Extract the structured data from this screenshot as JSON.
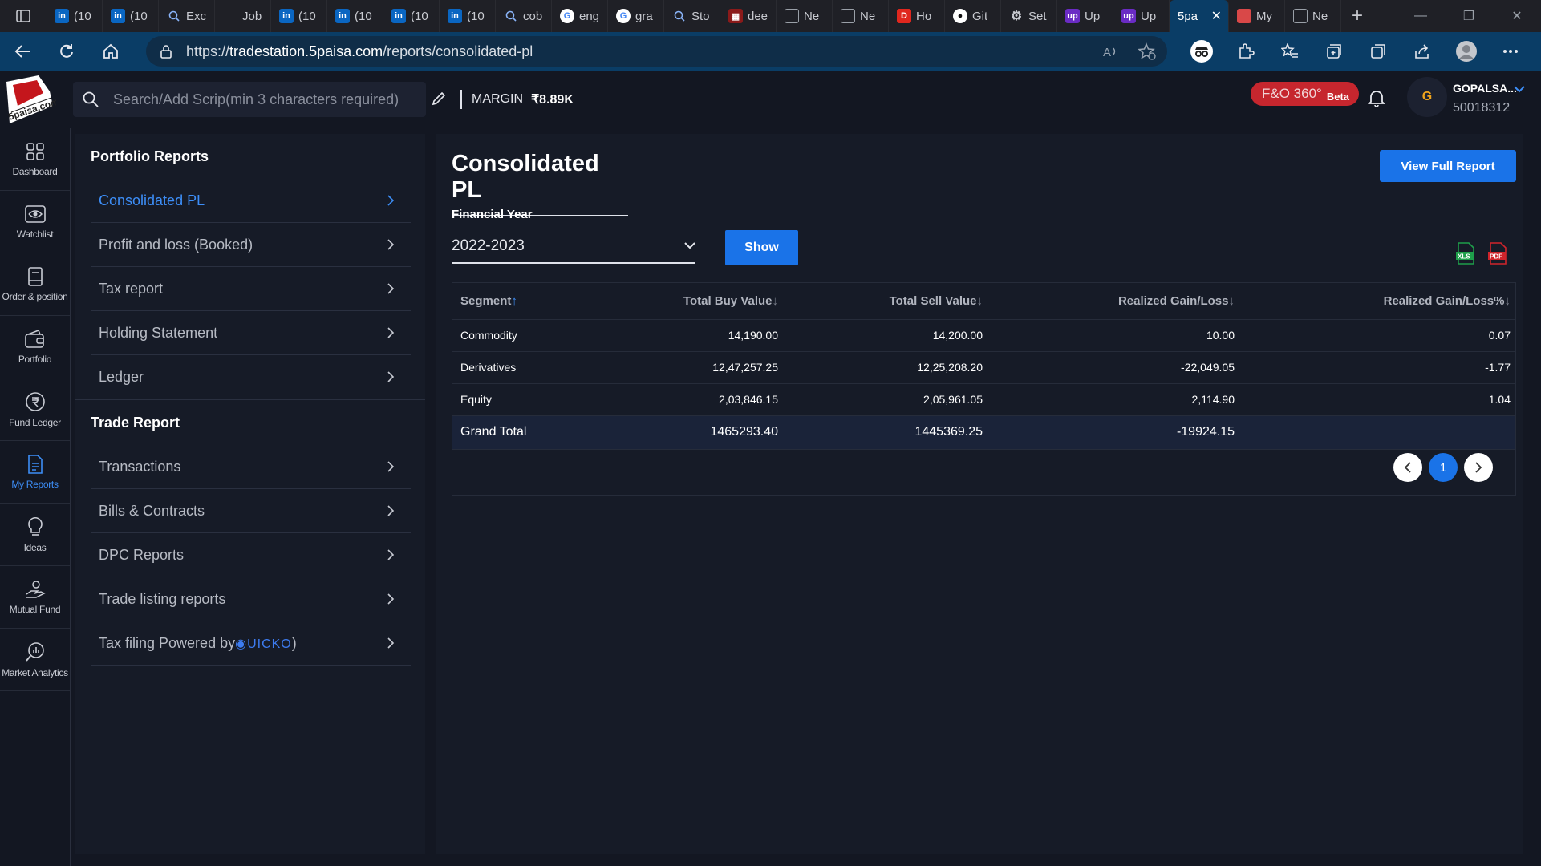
{
  "browser": {
    "tabs": [
      {
        "label": "",
        "icon": "window-icon"
      },
      {
        "label": "(10",
        "icon": "linkedin-icon"
      },
      {
        "label": "(10",
        "icon": "linkedin-icon"
      },
      {
        "label": "Exc",
        "icon": "search-icon"
      },
      {
        "label": "Job",
        "icon": "blank-icon"
      },
      {
        "label": "(10",
        "icon": "linkedin-icon"
      },
      {
        "label": "(10",
        "icon": "linkedin-icon"
      },
      {
        "label": "(10",
        "icon": "linkedin-icon"
      },
      {
        "label": "(10",
        "icon": "linkedin-icon"
      },
      {
        "label": "cob",
        "icon": "search-icon"
      },
      {
        "label": "eng",
        "icon": "google-icon"
      },
      {
        "label": "gra",
        "icon": "google-icon"
      },
      {
        "label": "Sto",
        "icon": "search-icon"
      },
      {
        "label": "dee",
        "icon": "pdf-icon"
      },
      {
        "label": "Ne",
        "icon": "newtab-icon"
      },
      {
        "label": "Ne",
        "icon": "newtab-icon"
      },
      {
        "label": "Ho",
        "icon": "d-icon"
      },
      {
        "label": "Git",
        "icon": "github-icon"
      },
      {
        "label": "Set",
        "icon": "gear-icon"
      },
      {
        "label": "Up",
        "icon": "upwork-icon"
      },
      {
        "label": "Up",
        "icon": "upwork-icon"
      },
      {
        "label": "5pa",
        "icon": "active",
        "active": true
      },
      {
        "label": "My",
        "icon": "image-icon"
      },
      {
        "label": "Ne",
        "icon": "newtab-icon"
      }
    ],
    "url_prefix": "https://",
    "url_domain": "tradestation.5paisa.com",
    "url_path": "/reports/consolidated-pl"
  },
  "header": {
    "search_placeholder": "Search/Add Scrip(min 3 characters required)",
    "margin_label": "MARGIN",
    "margin_value": "₹8.89K",
    "fno_label": "F&O 360°",
    "fno_badge": "Beta",
    "avatar_initial": "G",
    "user_name": "GOPALSA...",
    "user_id": "50018312"
  },
  "leftnav": [
    {
      "label": "Dashboard",
      "icon": "dashboard-icon"
    },
    {
      "label": "Watchlist",
      "icon": "eye-icon"
    },
    {
      "label": "Order & position",
      "icon": "book-icon"
    },
    {
      "label": "Portfolio",
      "icon": "wallet-icon"
    },
    {
      "label": "Fund Ledger",
      "icon": "rupee-icon"
    },
    {
      "label": "My Reports",
      "icon": "report-icon",
      "active": true
    },
    {
      "label": "Ideas",
      "icon": "bulb-icon"
    },
    {
      "label": "Mutual Fund",
      "icon": "hand-coin-icon"
    },
    {
      "label": "Market Analytics",
      "icon": "analytics-icon"
    }
  ],
  "menu": {
    "portfolio_heading": "Portfolio Reports",
    "portfolio_items": [
      "Consolidated PL",
      "Profit and loss (Booked)",
      "Tax report",
      "Holding Statement",
      "Ledger"
    ],
    "trade_heading": "Trade Report",
    "trade_items": [
      "Transactions",
      "Bills & Contracts",
      "DPC Reports",
      "Trade listing reports"
    ],
    "tax_filing_label": "Tax filing Powered by ",
    "tax_filing_brand": "UICKO",
    "tax_filing_close": ")"
  },
  "main": {
    "title": "Consolidated PL",
    "view_full_report": "View Full Report",
    "financial_year_label": "Financial Year",
    "financial_year_value": "2022-2023",
    "show_button": "Show",
    "table": {
      "headers": [
        "Segment",
        "Total Buy Value",
        "Total Sell Value",
        "Realized Gain/Loss",
        "Realized Gain/Loss%"
      ],
      "rows": [
        [
          "Commodity",
          "14,190.00",
          "14,200.00",
          "10.00",
          "0.07"
        ],
        [
          "Derivatives",
          "12,47,257.25",
          "12,25,208.20",
          "-22,049.05",
          "-1.77"
        ],
        [
          "Equity",
          "2,03,846.15",
          "2,05,961.05",
          "2,114.90",
          "1.04"
        ]
      ],
      "total": [
        "Grand Total",
        "1465293.40",
        "1445369.25",
        "-19924.15",
        ""
      ]
    },
    "pagination": {
      "current": "1"
    }
  },
  "colors": {
    "accent": "#1a73e8",
    "active_link": "#3d8ef7",
    "background": "#131722",
    "panel": "#161b27",
    "fno_badge": "#c6262e"
  }
}
